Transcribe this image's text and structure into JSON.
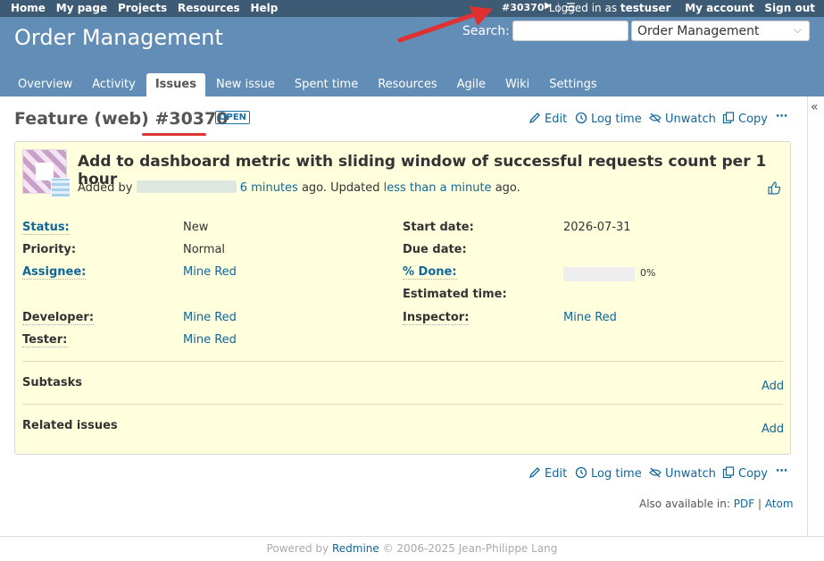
{
  "top_menu": {
    "left": [
      "Home",
      "My page",
      "Projects",
      "Resources",
      "Help"
    ],
    "issue_nav": "#30370",
    "logged_in_prefix": "Logged in as",
    "username": "testuser",
    "my_account": "My account",
    "sign_out": "Sign out"
  },
  "header": {
    "title": "Order Management",
    "search_label": "Search:",
    "search_value": "",
    "project_select": "Order Management"
  },
  "tabs": [
    {
      "label": "Overview",
      "selected": false
    },
    {
      "label": "Activity",
      "selected": false
    },
    {
      "label": "Issues",
      "selected": true
    },
    {
      "label": "New issue",
      "selected": false
    },
    {
      "label": "Spent time",
      "selected": false
    },
    {
      "label": "Resources",
      "selected": false
    },
    {
      "label": "Agile",
      "selected": false
    },
    {
      "label": "Wiki",
      "selected": false
    },
    {
      "label": "Settings",
      "selected": false
    }
  ],
  "issue": {
    "tracker": "Feature (web)",
    "number": "#30370",
    "status_badge": "OPEN",
    "subject": "Add to dashboard metric with sliding window of successful requests count per 1 hour",
    "added_by": "Added by",
    "created_ago": "6 minutes",
    "updated_text": "ago. Updated",
    "updated_ago": "less than a minute",
    "ago": "ago.",
    "done_ratio": 0
  },
  "actions": {
    "edit": "Edit",
    "log_time": "Log time",
    "unwatch": "Unwatch",
    "copy": "Copy"
  },
  "attributes": {
    "status_label": "Status:",
    "status_value": "New",
    "priority_label": "Priority:",
    "priority_value": "Normal",
    "assignee_label": "Assignee:",
    "assignee_value": "Mine Red",
    "developer_label": "Developer:",
    "developer_value": "Mine Red",
    "tester_label": "Tester:",
    "tester_value": "Mine Red",
    "start_label": "Start date:",
    "start_value": "2026-07-31",
    "due_label": "Due date:",
    "due_value": "",
    "done_label": "% Done:",
    "done_value": "0%",
    "estimated_label": "Estimated time:",
    "estimated_value": "",
    "inspector_label": "Inspector:",
    "inspector_value": "Mine Red"
  },
  "sections": {
    "subtasks": "Subtasks",
    "related": "Related issues",
    "add": "Add"
  },
  "also_available": {
    "prefix": "Also available in:",
    "pdf": "PDF",
    "atom": "Atom"
  },
  "footer": {
    "prefix": "Powered by",
    "link": "Redmine",
    "suffix": "© 2006-2025 Jean-Philippe Lang"
  },
  "colors": {
    "top_menu": "#3e5b76",
    "header": "#628db6",
    "issue_box": "#ffffdd",
    "link": "#169",
    "annotation_red": "#e03030"
  }
}
